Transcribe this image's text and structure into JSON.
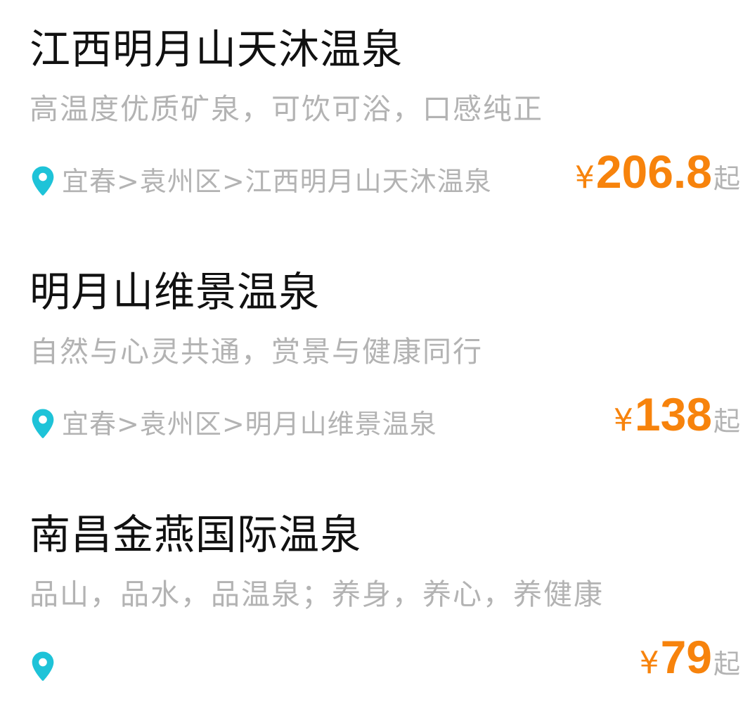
{
  "colors": {
    "title": "#111111",
    "subtle": "#b3b3b3",
    "price": "#f7830c",
    "pin": "#1ec3d8"
  },
  "items": [
    {
      "title": "江西明月山天沐温泉",
      "slogan": "高温度优质矿泉，可饮可浴，口感纯正",
      "location": "宜春>袁州区>江西明月山天沐温泉",
      "location_icon": "location-pin-icon",
      "currency": "¥",
      "price": "206.8",
      "price_suffix": "起"
    },
    {
      "title": "明月山维景温泉",
      "slogan": "自然与心灵共通，赏景与健康同行",
      "location": "宜春>袁州区>明月山维景温泉",
      "location_icon": "location-pin-icon",
      "currency": "¥",
      "price": "138",
      "price_suffix": "起"
    },
    {
      "title": "南昌金燕国际温泉",
      "slogan": "品山，品水，品温泉；养身，养心，养健康",
      "location": "",
      "location_icon": "location-pin-icon",
      "currency": "¥",
      "price": "79",
      "price_suffix": "起"
    }
  ]
}
